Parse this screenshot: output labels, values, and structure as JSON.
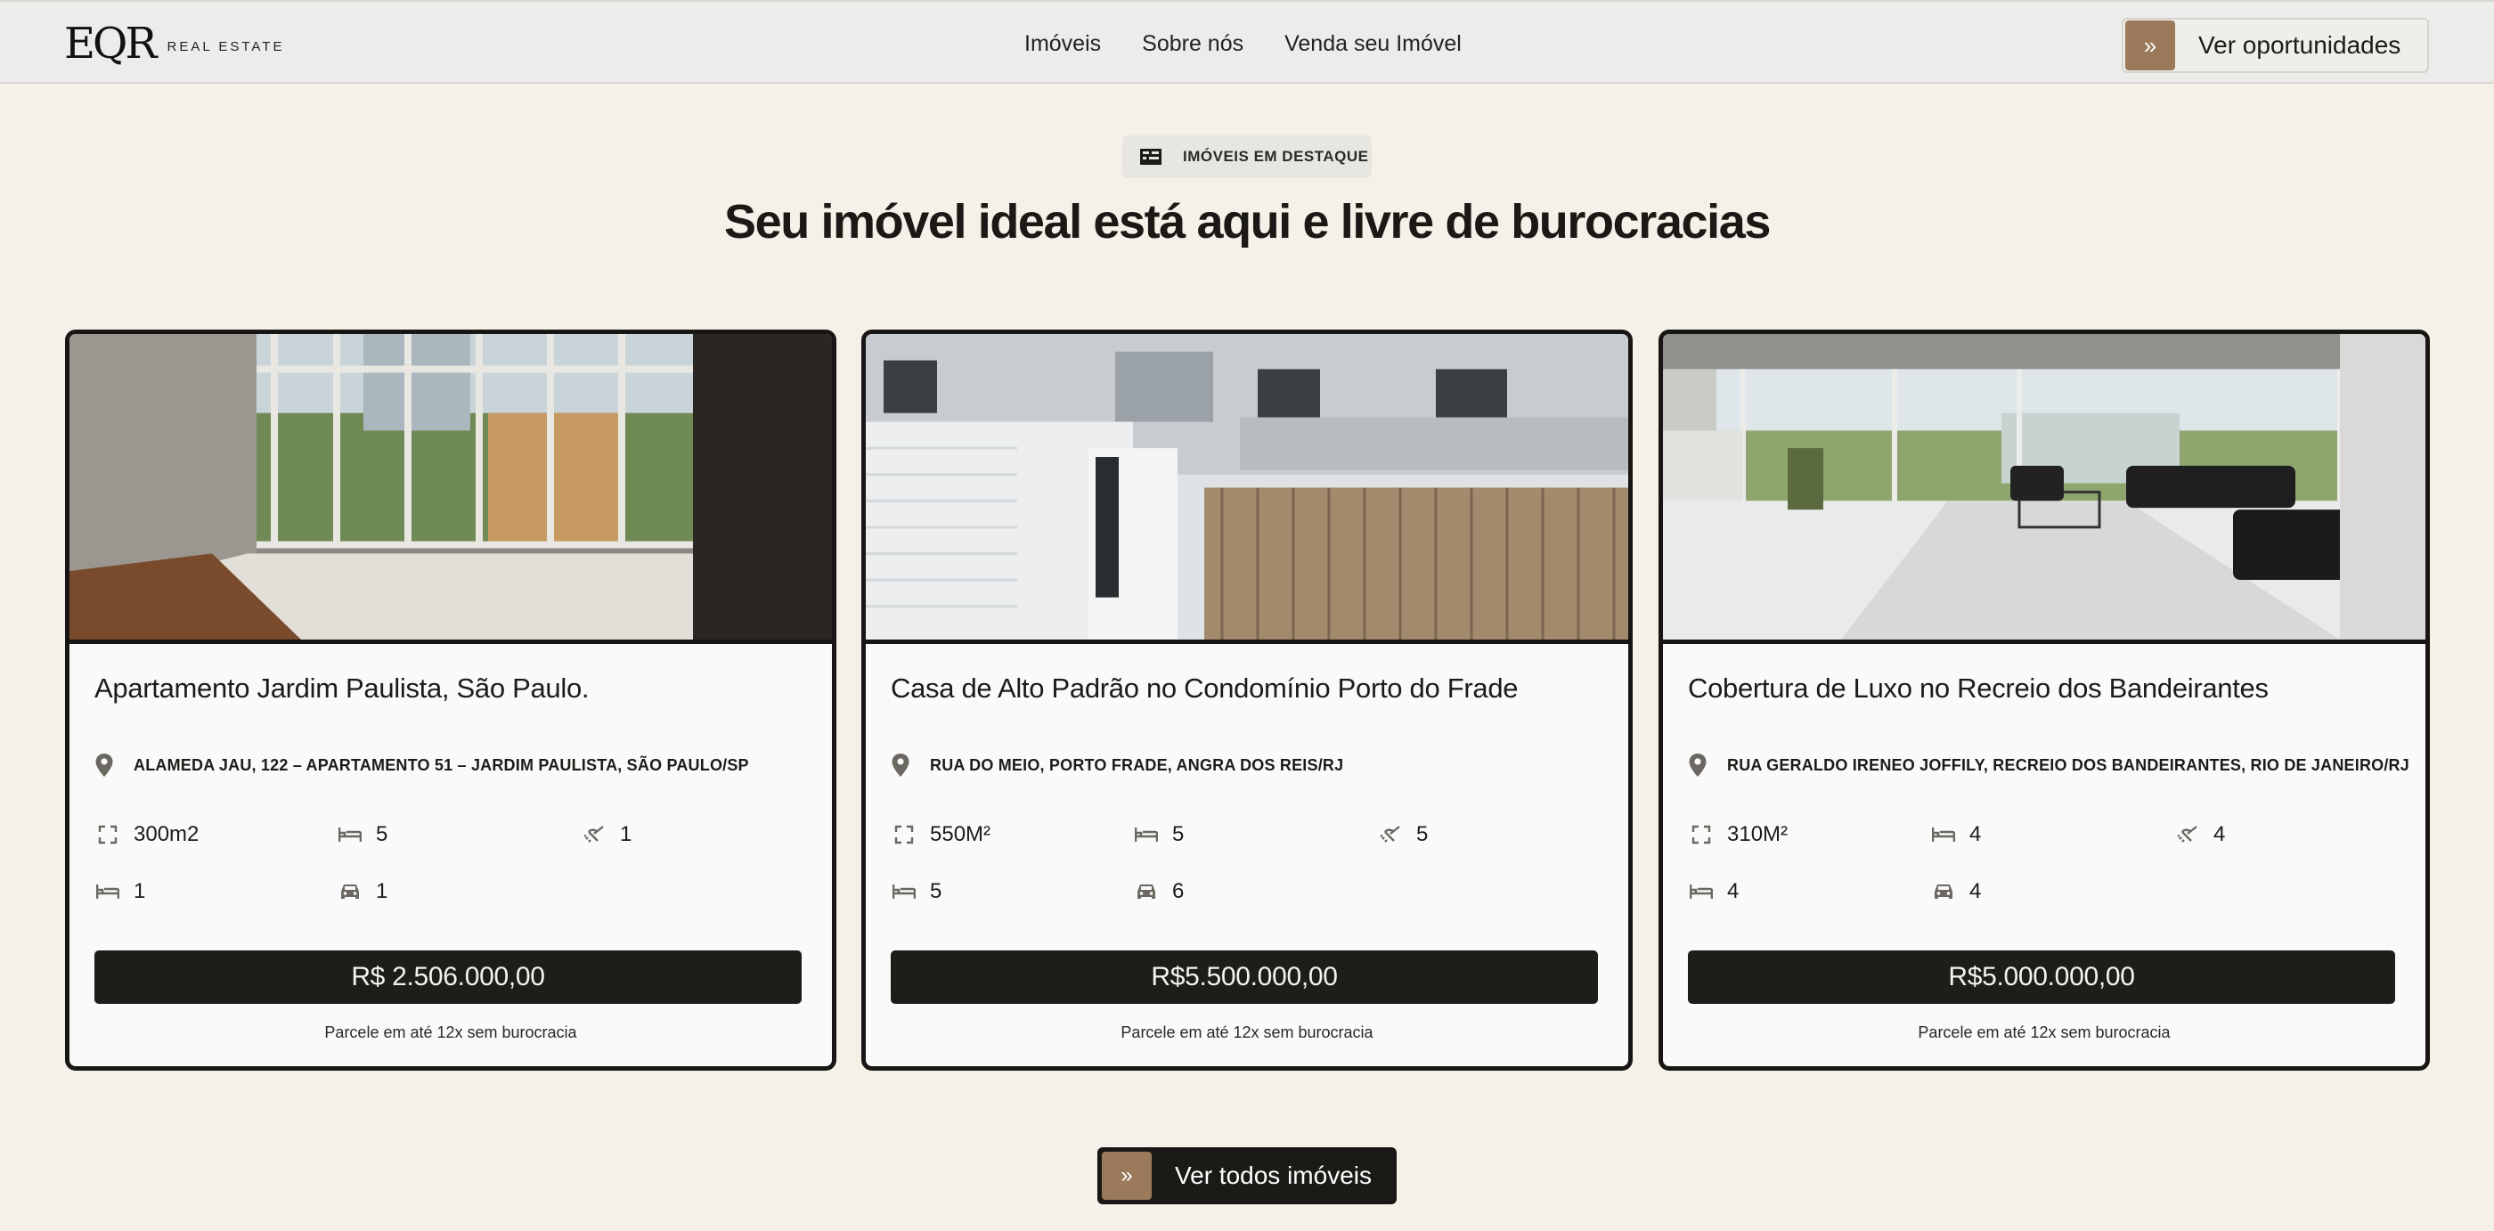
{
  "brand": {
    "mark": "EQR",
    "sub": "REAL ESTATE"
  },
  "nav": [
    "Imóveis",
    "Sobre nós",
    "Venda seu Imóvel"
  ],
  "header_cta": "Ver oportunidades",
  "section": {
    "badge": "IMÓVEIS EM DESTAQUE",
    "title": "Seu imóvel ideal está aqui e livre de burocracias"
  },
  "cards": [
    {
      "name": "Apartamento Jardim Paulista, São Paulo.",
      "address": "ALAMEDA JAU, 122 – APARTAMENTO 51 – JARDIM PAULISTA, SÃO PAULO/SP",
      "area": "300m2",
      "bedrooms": "5",
      "bathrooms": "1",
      "suites": "1",
      "parking": "1",
      "price": "R$ 2.506.000,00",
      "installments": "Parcele em até 12x sem burocracia"
    },
    {
      "name": "Casa de Alto Padrão no Condomínio Porto do Frade",
      "address": "RUA DO MEIO, PORTO FRADE, ANGRA DOS REIS/RJ",
      "area": "550M²",
      "bedrooms": "5",
      "bathrooms": "5",
      "suites": "5",
      "parking": "6",
      "price": "R$5.500.000,00",
      "installments": "Parcele em até 12x sem burocracia"
    },
    {
      "name": "Cobertura de Luxo no Recreio dos Bandeirantes",
      "address": "RUA GERALDO IRENEO JOFFILY, RECREIO DOS BANDEIRANTES, RIO DE JANEIRO/RJ",
      "area": "310M²",
      "bedrooms": "4",
      "bathrooms": "4",
      "suites": "4",
      "parking": "4",
      "price": "R$5.000.000,00",
      "installments": "Parcele em até 12x sem burocracia"
    }
  ],
  "bottom_cta": "Ver todos imóveis",
  "colors": {
    "accent": "#9a7a5a",
    "dark": "#1e1d1a",
    "background": "#f5f1e8"
  }
}
